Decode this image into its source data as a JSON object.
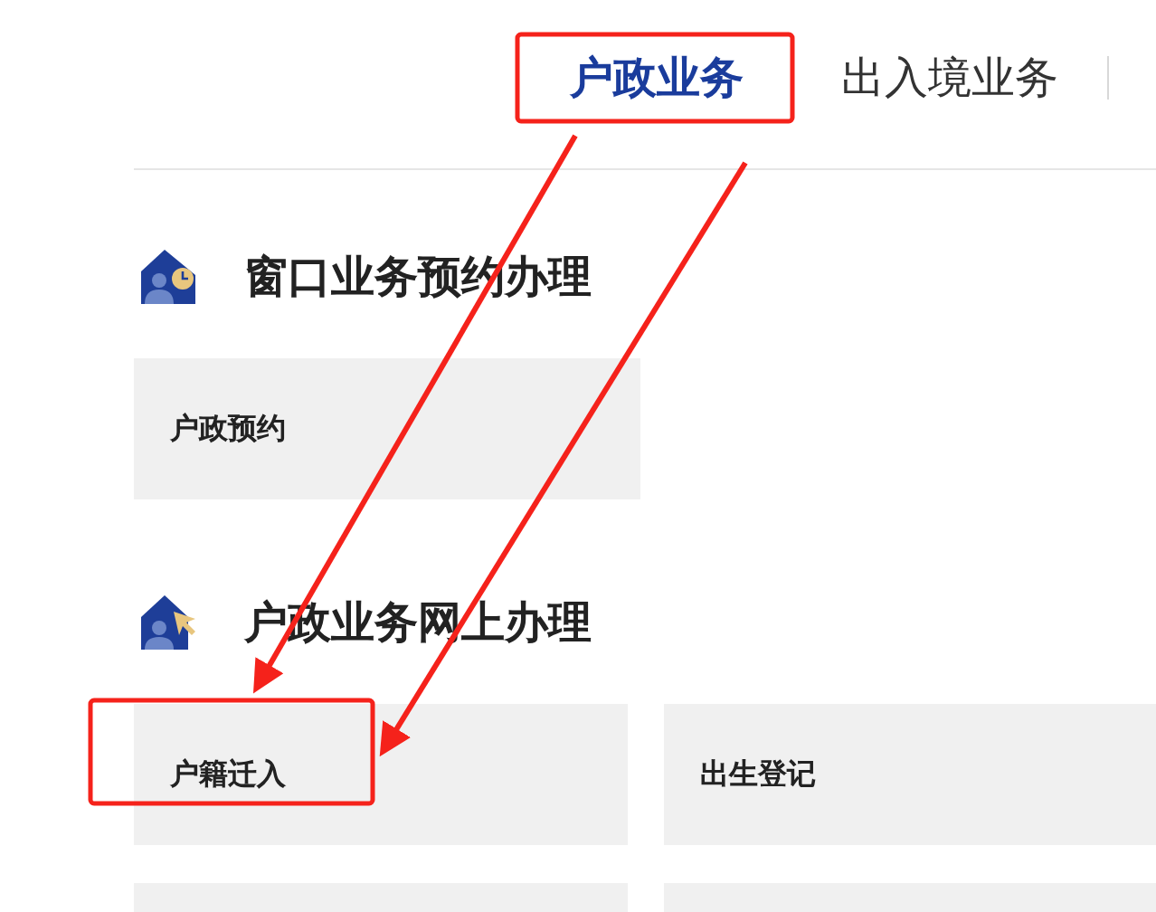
{
  "tabs": [
    {
      "label": "户政业务",
      "selected": true
    },
    {
      "label": "出入境业务",
      "selected": false
    }
  ],
  "sections": [
    {
      "title": "窗口业务预约办理",
      "items": [
        {
          "kind": "service",
          "label": "户政预约"
        }
      ]
    },
    {
      "title": "户政业务网上办理",
      "items": [
        {
          "kind": "service",
          "label": "户籍迁入"
        },
        {
          "kind": "service",
          "label": "出生登记"
        },
        {
          "kind": "empty"
        },
        {
          "kind": "empty"
        }
      ]
    }
  ]
}
